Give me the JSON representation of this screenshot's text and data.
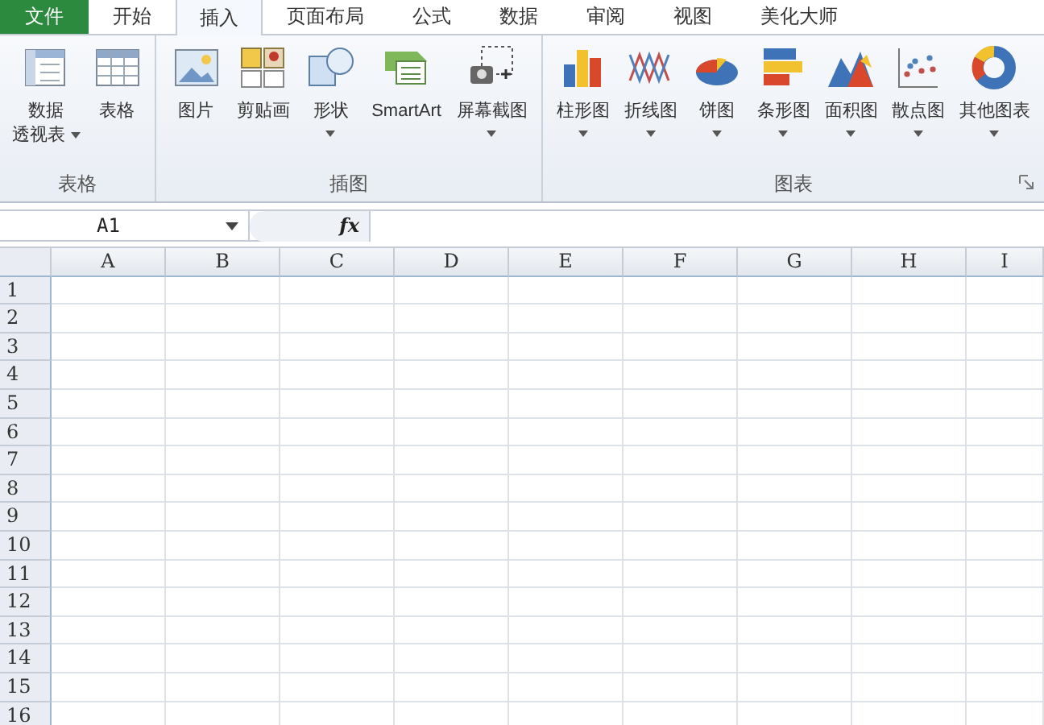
{
  "menu_tabs": [
    {
      "label": "文件",
      "kind": "file",
      "selected": false
    },
    {
      "label": "开始",
      "kind": "tab",
      "selected": false
    },
    {
      "label": "插入",
      "kind": "tab",
      "selected": true
    },
    {
      "label": "页面布局",
      "kind": "tab",
      "selected": false
    },
    {
      "label": "公式",
      "kind": "tab",
      "selected": false
    },
    {
      "label": "数据",
      "kind": "tab",
      "selected": false
    },
    {
      "label": "审阅",
      "kind": "tab",
      "selected": false
    },
    {
      "label": "视图",
      "kind": "tab",
      "selected": false
    },
    {
      "label": "美化大师",
      "kind": "tab",
      "selected": false
    }
  ],
  "ribbon_groups": [
    {
      "title": "表格",
      "launcher": false,
      "buttons": [
        {
          "label_lines": [
            "数据",
            "透视表"
          ],
          "dropdown": true
        },
        {
          "label_lines": [
            "表格"
          ],
          "dropdown": false
        }
      ]
    },
    {
      "title": "插图",
      "launcher": false,
      "buttons": [
        {
          "label_lines": [
            "图片"
          ],
          "dropdown": false
        },
        {
          "label_lines": [
            "剪贴画"
          ],
          "dropdown": false
        },
        {
          "label_lines": [
            "形状"
          ],
          "dropdown": true
        },
        {
          "label_lines": [
            "SmartArt"
          ],
          "dropdown": false
        },
        {
          "label_lines": [
            "屏幕截图"
          ],
          "dropdown": true
        }
      ]
    },
    {
      "title": "图表",
      "launcher": true,
      "buttons": [
        {
          "label_lines": [
            "柱形图"
          ],
          "dropdown": true
        },
        {
          "label_lines": [
            "折线图"
          ],
          "dropdown": true
        },
        {
          "label_lines": [
            "饼图"
          ],
          "dropdown": true
        },
        {
          "label_lines": [
            "条形图"
          ],
          "dropdown": true
        },
        {
          "label_lines": [
            "面积图"
          ],
          "dropdown": true
        },
        {
          "label_lines": [
            "散点图"
          ],
          "dropdown": true
        },
        {
          "label_lines": [
            "其他图表"
          ],
          "dropdown": true
        }
      ]
    }
  ],
  "formula_bar": {
    "name_box": "A1",
    "function_label": "fx"
  },
  "sheet": {
    "columns": [
      "A",
      "B",
      "C",
      "D",
      "E",
      "F",
      "G",
      "H",
      "I"
    ],
    "rows": [
      "1",
      "2",
      "3",
      "4",
      "5",
      "6",
      "7",
      "8",
      "9",
      "10",
      "11",
      "12",
      "13",
      "14",
      "15",
      "16"
    ]
  }
}
